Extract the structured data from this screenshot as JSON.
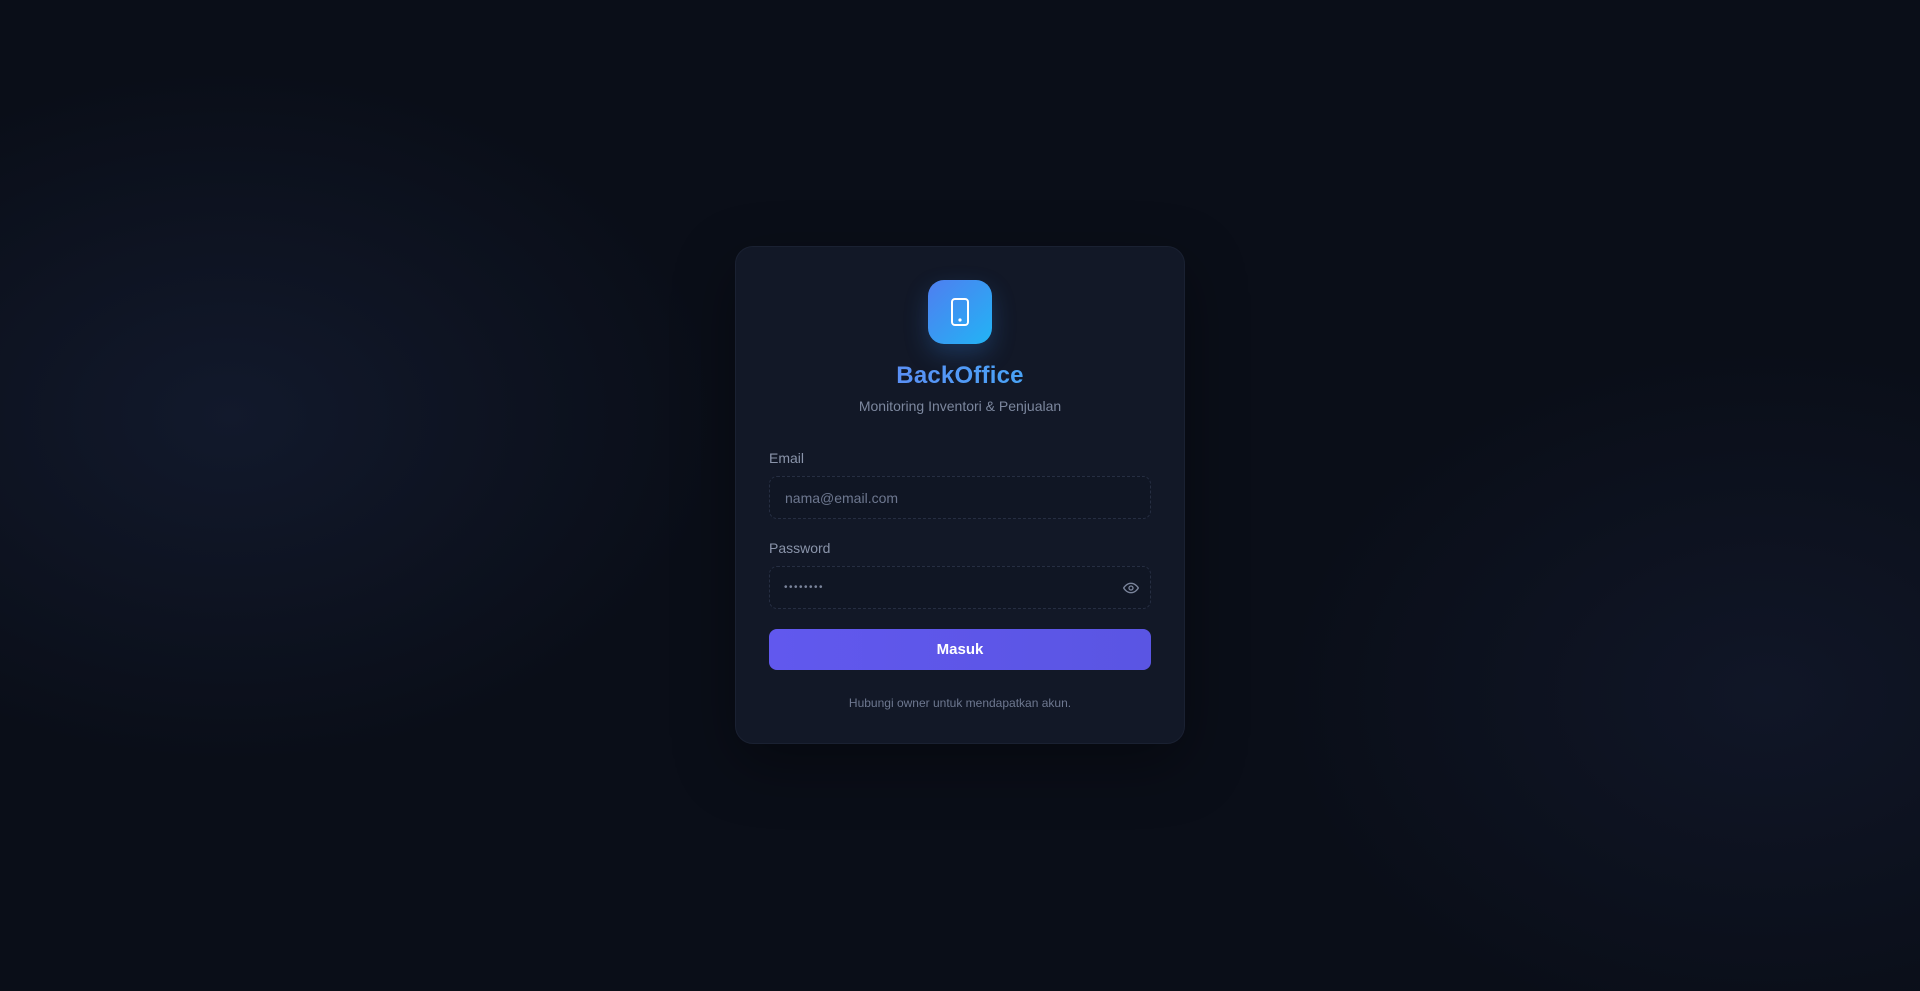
{
  "app": {
    "brand": "BackOffice",
    "tagline": "Monitoring Inventori & Penjualan",
    "logo_icon": "tablet-icon"
  },
  "form": {
    "email_label": "Email",
    "email_placeholder": "nama@email.com",
    "email_value": "",
    "password_label": "Password",
    "password_masked": "••••••••",
    "toggle_icon": "eye-icon",
    "submit_label": "Masuk"
  },
  "footer": {
    "note": "Hubungi owner untuk mendapatkan akun."
  },
  "colors": {
    "background": "#0a0e18",
    "card": "#121827",
    "accent": "#5a55e3",
    "brand_gradient_start": "#6b7df5",
    "brand_gradient_end": "#38b6f6"
  }
}
